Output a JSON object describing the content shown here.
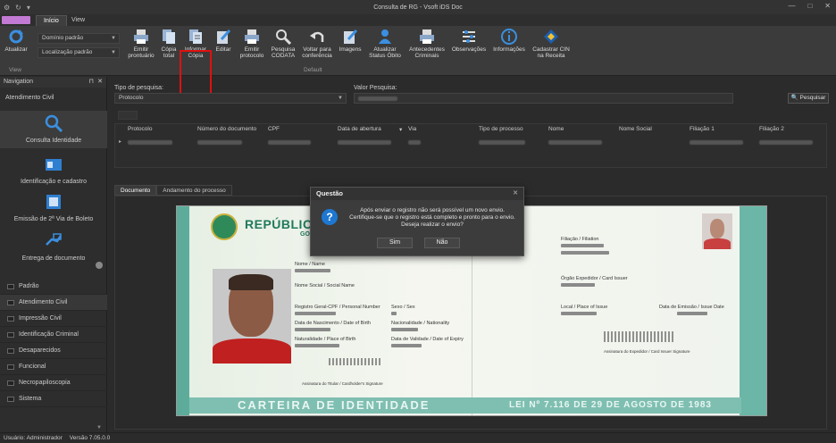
{
  "window": {
    "title": "Consulta de RG - Vsoft iDS Doc"
  },
  "ribbon_tabs": {
    "home": "Início",
    "view": "View"
  },
  "ribbon": {
    "atualizar": "Atualizar",
    "dominio_combo": "Domínio padrão",
    "localizacao_combo": "Localização padrão",
    "view_group": "View",
    "default_group": "Default",
    "buttons": [
      {
        "line1": "Emitir",
        "line2": "prontuário"
      },
      {
        "line1": "Cópia",
        "line2": "total"
      },
      {
        "line1": "Informar",
        "line2": "Cópia"
      },
      {
        "line1": "Editar",
        "line2": ""
      },
      {
        "line1": "Emitir",
        "line2": "protocolo"
      },
      {
        "line1": "Pesquisa",
        "line2": "CODATA"
      },
      {
        "line1": "Voltar para",
        "line2": "conferência"
      },
      {
        "line1": "Imagens",
        "line2": ""
      },
      {
        "line1": "Atualizar",
        "line2": "Status Óbito"
      },
      {
        "line1": "Antecedentes",
        "line2": "Criminais"
      },
      {
        "line1": "Observações",
        "line2": ""
      },
      {
        "line1": "Informações",
        "line2": ""
      },
      {
        "line1": "Cadastrar CIN",
        "line2": "na Receita"
      }
    ]
  },
  "nav": {
    "header": "Navigation",
    "section": "Atendimento Civil",
    "big_items": [
      "Consulta Identidade",
      "Identificação e cadastro",
      "Emissão de 2ª Via de Boleto",
      "Entrega de documento"
    ],
    "list_items": [
      "Padrão",
      "Atendimento Civil",
      "Impressão Civil",
      "Identificação Criminal",
      "Desaparecidos",
      "Funcional",
      "Necropapiloscopia",
      "Sistema"
    ]
  },
  "search": {
    "tipo_label": "Tipo de pesquisa:",
    "tipo_value": "Protocolo",
    "valor_label": "Valor Pesquisa:",
    "button": "Pesquisar"
  },
  "grid": {
    "columns": [
      "Protocolo",
      "Número do documento",
      "CPF",
      "Data de abertura",
      "Via",
      "Tipo de processo",
      "Nome",
      "Nome Social",
      "Filiação 1",
      "Filiação 2"
    ]
  },
  "doc_tabs": [
    "Documento",
    "Andamento do processo"
  ],
  "card": {
    "title": "REPÚBLICA F",
    "subtitle": "GOV",
    "fields": {
      "nome": "Nome / Name",
      "nome_social": "Nome Social / Social Name",
      "registro": "Registro Geral-CPF / Personal Number",
      "sexo": "Sexo / Sex",
      "nascimento": "Data de Nascimento / Date of Birth",
      "nacionalidade": "Nacionalidade / Nationality",
      "naturalidade": "Naturalidade / Place of Birth",
      "validade": "Data de Validade / Date of Expiry",
      "assinatura": "Assinatura do Titular / Cardholder's Signature",
      "filiacao": "Filiação / Filiation",
      "orgao": "Órgão Expedidor / Card Issuer",
      "local": "Local / Place of Issue",
      "emissao": "Data de Emissão / Issue Date",
      "assin_exp": "Assinatura do Expedidor / Card Issuer Signature"
    },
    "banner_left": "CARTEIRA DE IDENTIDADE",
    "banner_right": "LEI Nº 7.116 DE 29 DE AGOSTO DE 1983"
  },
  "dialog": {
    "title": "Questão",
    "line1": "Após enviar o registro não será possível um novo envio.",
    "line2": "Certifique-se que o registro está completo e pronto para o envio.",
    "line3": "Deseja realizar o envio?",
    "yes": "Sim",
    "no": "Não"
  },
  "status": {
    "user": "Usuário: Administrador",
    "version": "Versão 7.05.0.0"
  }
}
